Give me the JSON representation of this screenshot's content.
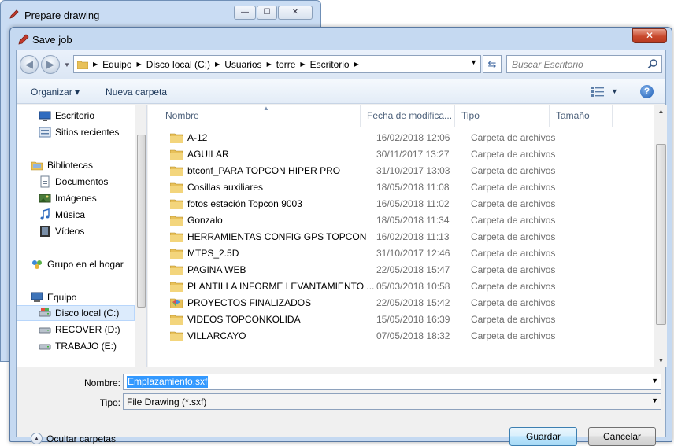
{
  "background_window": {
    "title": "Prepare drawing",
    "controls": [
      "—",
      "☐",
      "✕"
    ]
  },
  "dialog": {
    "title": "Save job",
    "close_label": "✕"
  },
  "address_bar": {
    "crumbs": [
      "Equipo",
      "Disco local (C:)",
      "Usuarios",
      "torre",
      "Escritorio"
    ],
    "search_placeholder": "Buscar Escritorio"
  },
  "toolbar": {
    "organize_label": "Organizar ▾",
    "new_folder_label": "Nueva carpeta"
  },
  "nav_pane": {
    "items": [
      {
        "label": "Escritorio",
        "icon": "desktop-icon"
      },
      {
        "label": "Sitios recientes",
        "icon": "recent-places-icon"
      },
      {
        "label": "Bibliotecas",
        "icon": "libraries-icon"
      },
      {
        "label": "Documentos",
        "icon": "documents-icon"
      },
      {
        "label": "Imágenes",
        "icon": "pictures-icon"
      },
      {
        "label": "Música",
        "icon": "music-icon"
      },
      {
        "label": "Vídeos",
        "icon": "videos-icon"
      },
      {
        "label": "Grupo en el hogar",
        "icon": "homegroup-icon"
      },
      {
        "label": "Equipo",
        "icon": "computer-icon"
      },
      {
        "label": "Disco local (C:)",
        "icon": "drive-icon"
      },
      {
        "label": "RECOVER (D:)",
        "icon": "drive-icon"
      },
      {
        "label": "TRABAJO (E:)",
        "icon": "drive-icon"
      }
    ]
  },
  "file_list": {
    "columns": [
      "Nombre",
      "Fecha de modifica...",
      "Tipo",
      "Tamaño"
    ],
    "rows": [
      {
        "name": "A-12",
        "date": "16/02/2018 12:06",
        "type": "Carpeta de archivos"
      },
      {
        "name": "AGUILAR",
        "date": "30/11/2017 13:27",
        "type": "Carpeta de archivos"
      },
      {
        "name": "btconf_PARA TOPCON HIPER PRO",
        "date": "31/10/2017 13:03",
        "type": "Carpeta de archivos"
      },
      {
        "name": "Cosillas auxiliares",
        "date": "18/05/2018 11:08",
        "type": "Carpeta de archivos"
      },
      {
        "name": "fotos estación Topcon 9003",
        "date": "16/05/2018 11:02",
        "type": "Carpeta de archivos"
      },
      {
        "name": "Gonzalo",
        "date": "18/05/2018 11:34",
        "type": "Carpeta de archivos"
      },
      {
        "name": "HERRAMIENTAS CONFIG GPS TOPCON",
        "date": "16/02/2018 11:13",
        "type": "Carpeta de archivos"
      },
      {
        "name": "MTPS_2.5D",
        "date": "31/10/2017 12:46",
        "type": "Carpeta de archivos"
      },
      {
        "name": "PAGINA WEB",
        "date": "22/05/2018 15:47",
        "type": "Carpeta de archivos"
      },
      {
        "name": "PLANTILLA INFORME LEVANTAMIENTO ...",
        "date": "05/03/2018 10:58",
        "type": "Carpeta de archivos"
      },
      {
        "name": "PROYECTOS FINALIZADOS",
        "date": "22/05/2018 15:42",
        "type": "Carpeta de archivos",
        "special": true
      },
      {
        "name": "VIDEOS TOPCONKOLIDA",
        "date": "15/05/2018 16:39",
        "type": "Carpeta de archivos"
      },
      {
        "name": "VILLARCAYO",
        "date": "07/05/2018 18:32",
        "type": "Carpeta de archivos"
      }
    ]
  },
  "form": {
    "name_label": "Nombre:",
    "name_value": "Emplazamiento.sxf",
    "type_label": "Tipo:",
    "type_value": "File Drawing (*.sxf)"
  },
  "footer": {
    "hide_folders_label": "Ocultar carpetas",
    "save_label": "Guardar",
    "cancel_label": "Cancelar"
  },
  "colors": {
    "folder": "#e8c15a",
    "selection": "#3399ff",
    "frame": "#c5d9f1"
  }
}
